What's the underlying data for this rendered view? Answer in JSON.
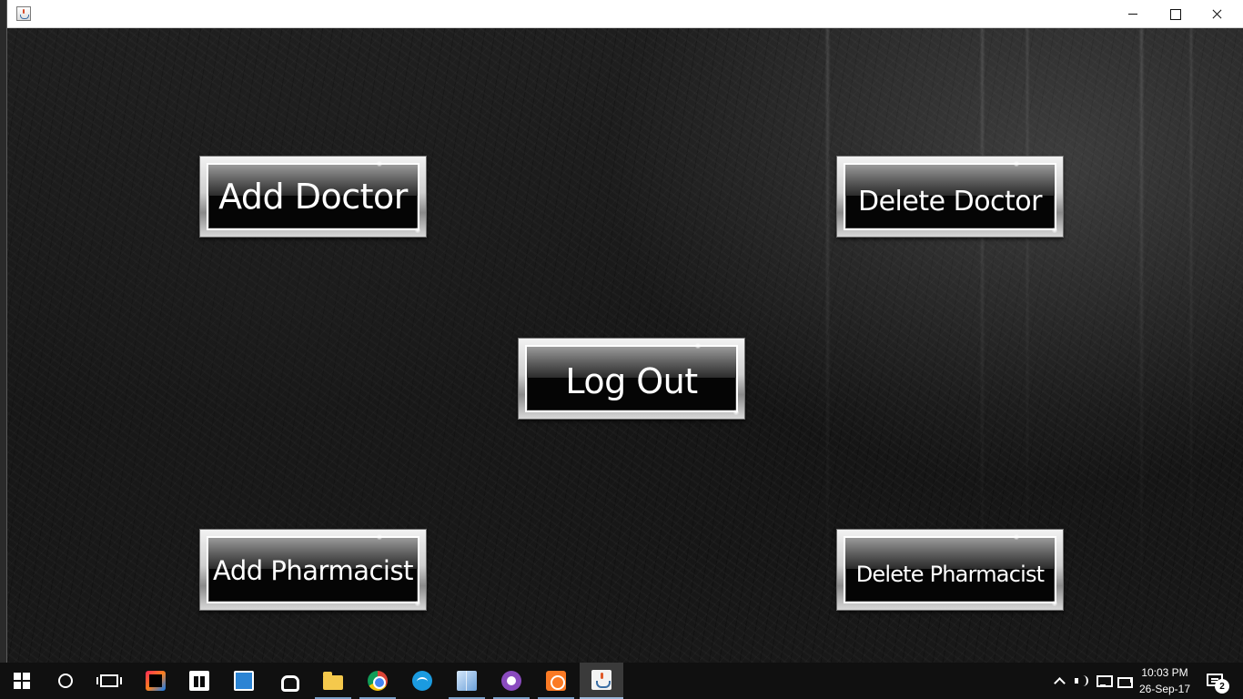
{
  "window": {
    "controls": {
      "minimize_icon": "minimize-icon",
      "maximize_icon": "maximize-icon",
      "close_icon": "close-icon"
    }
  },
  "main": {
    "buttons": {
      "add_doctor": "Add Doctor",
      "delete_doctor": "Delete Doctor",
      "log_out": "Log Out",
      "add_pharmacist": "Add Pharmacist",
      "delete_pharmacist": "Delete Pharmacist"
    },
    "button_text_color": "#ffffff"
  },
  "taskbar": {
    "pinned": [
      "windows-start",
      "cortana",
      "task-view",
      "intellij-idea",
      "microsoft-store",
      "video-app",
      "iheartradio",
      "file-explorer",
      "google-chrome",
      "wifi-app",
      "virtualbox",
      "cat-app",
      "xampp",
      "java-app"
    ],
    "clock": {
      "time": "10:03 PM",
      "date": "26-Sep-17"
    },
    "notifications": {
      "count": "2"
    }
  }
}
